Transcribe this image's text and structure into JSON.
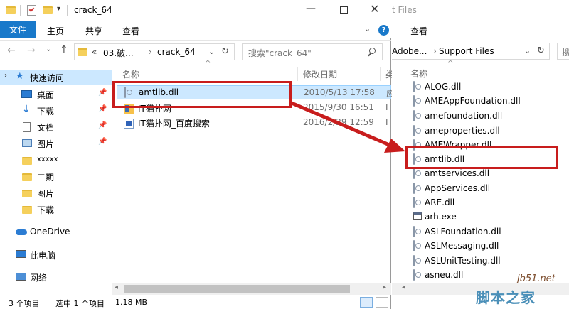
{
  "left_window": {
    "title": "crack_64",
    "ribbon_tabs": [
      "文件",
      "主页",
      "共享",
      "查看"
    ],
    "breadcrumb_prefix": "«",
    "breadcrumb": [
      "03.破...",
      "crack_64"
    ],
    "search_placeholder": "搜索\"crack_64\"",
    "col_name": "名称",
    "col_date": "修改日期",
    "col_type": "类",
    "quick_access_label": "快速访问",
    "nav_items": [
      "桌面",
      "下载",
      "文档",
      "图片",
      "xxxxx",
      "二期",
      "图片",
      "下载"
    ],
    "onedrive_label": "OneDrive",
    "thispc_label": "此电脑",
    "network_label": "网络",
    "files": [
      {
        "name": "amtlib.dll",
        "date": "2010/5/13 17:58",
        "type": "应"
      },
      {
        "name": "IT猫扑网",
        "date": "2015/9/30 16:51",
        "type": "I"
      },
      {
        "name": "IT猫扑网_百度搜索",
        "date": "2016/2/29 12:59",
        "type": "I"
      }
    ],
    "status_count": "3 个项目",
    "status_selected": "选中 1 个项目",
    "status_size": "1.18 MB"
  },
  "right_window": {
    "title_partial": "t Files",
    "ribbon_view": "查看",
    "breadcrumb": [
      "Adobe...",
      "Support Files"
    ],
    "col_name": "名称",
    "files": [
      "ALOG.dll",
      "AMEAppFoundation.dll",
      "amefoundation.dll",
      "ameproperties.dll",
      "AMEWrapper.dll",
      "amtlib.dll",
      "amtservices.dll",
      "AppServices.dll",
      "ARE.dll",
      "arh.exe",
      "ASLFoundation.dll",
      "ASLMessaging.dll",
      "ASLUnitTesting.dll",
      "asneu.dll"
    ]
  },
  "watermark": {
    "site": "jb51.net",
    "name": "脚本之家"
  }
}
